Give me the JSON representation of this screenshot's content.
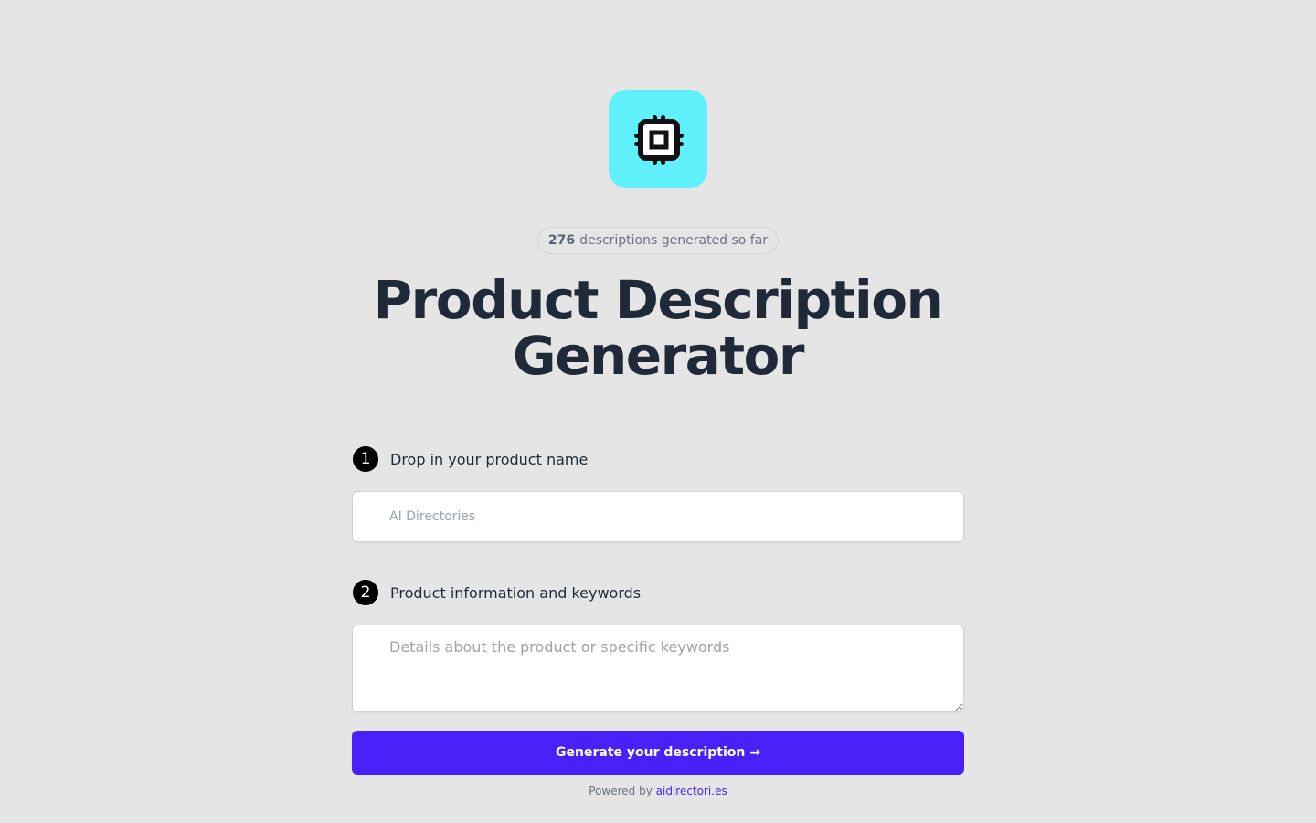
{
  "logo": {
    "icon": "cpu-chip-icon",
    "background": "#5ff0fb"
  },
  "counter": {
    "count": "276",
    "suffix": "descriptions generated so far"
  },
  "heading": {
    "line1": "Product Description",
    "line2": "Generator"
  },
  "steps": [
    {
      "number": "1",
      "label": "Drop in your product name"
    },
    {
      "number": "2",
      "label": "Product information and keywords"
    }
  ],
  "form": {
    "product_name_placeholder": "AI Directories",
    "product_name_value": "",
    "details_placeholder": "Details about the product or specific keywords",
    "details_value": ""
  },
  "button": {
    "label": "Generate your description →",
    "color": "#4a20f8"
  },
  "footer": {
    "prefix": "Powered by",
    "link_text": "aidirectori.es"
  }
}
